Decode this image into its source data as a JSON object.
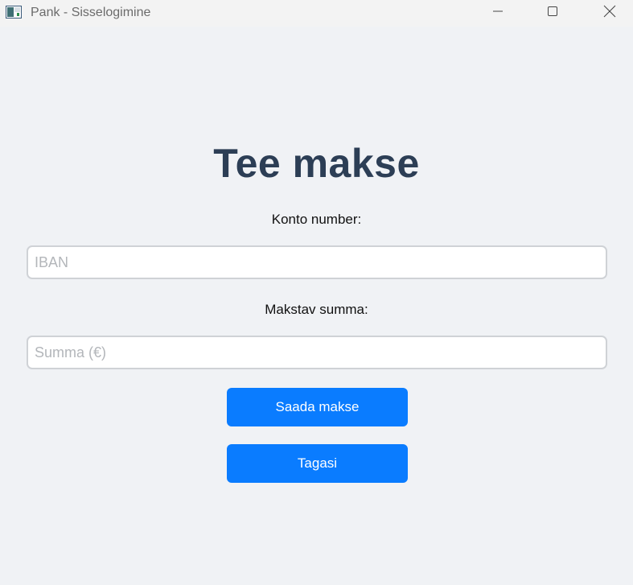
{
  "window": {
    "title": "Pank - Sisselogimine",
    "app_icon": "window-app-icon",
    "controls": {
      "minimize_icon": "minimize-icon",
      "maximize_icon": "maximize-icon",
      "close_icon": "close-icon"
    }
  },
  "main": {
    "heading": "Tee makse",
    "account": {
      "label": "Konto number:",
      "value": "",
      "placeholder": "IBAN"
    },
    "amount": {
      "label": "Makstav summa:",
      "value": "",
      "placeholder": "Summa (€)"
    },
    "send_button_label": "Saada makse",
    "back_button_label": "Tagasi"
  },
  "colors": {
    "background": "#f0f2f5",
    "heading": "#2c3e55",
    "button": "#0a7cff",
    "button_text": "#ffffff",
    "input_border": "#cfd2d6",
    "placeholder": "#b3b6ba"
  }
}
